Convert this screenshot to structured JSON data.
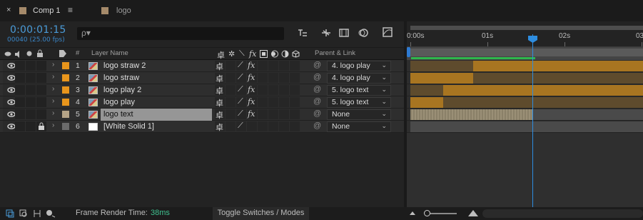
{
  "tabs": {
    "active": {
      "close": "×",
      "label": "Comp 1",
      "menu": "≡",
      "color": "#a58a6a"
    },
    "inactive": {
      "label": "logo",
      "color": "#a58a6a"
    }
  },
  "header": {
    "timecode": "0:00:01:15",
    "frames": "00040 (25.00 fps)",
    "search_glyph": "ρ▾"
  },
  "columns": {
    "hash": "#",
    "layer_name": "Layer Name",
    "parent_link": "Parent & Link"
  },
  "layers": [
    {
      "num": "1",
      "name": "logo straw 2",
      "label_color": "#e8951c",
      "parent": "4. logo play",
      "selected": false,
      "locked": false,
      "thumb": "footage"
    },
    {
      "num": "2",
      "name": "logo straw",
      "label_color": "#e8951c",
      "parent": "4. logo play",
      "selected": false,
      "locked": false,
      "thumb": "footage"
    },
    {
      "num": "3",
      "name": "logo play 2",
      "label_color": "#e8951c",
      "parent": "5. logo text",
      "selected": false,
      "locked": false,
      "thumb": "footage"
    },
    {
      "num": "4",
      "name": "logo play",
      "label_color": "#e8951c",
      "parent": "5. logo text",
      "selected": false,
      "locked": false,
      "thumb": "footage"
    },
    {
      "num": "5",
      "name": "logo text",
      "label_color": "#b5a487",
      "parent": "None",
      "selected": true,
      "locked": false,
      "thumb": "footage"
    },
    {
      "num": "6",
      "name": "[White Solid 1]",
      "label_color": "#6b6b6b",
      "parent": "None",
      "selected": false,
      "locked": true,
      "thumb": "white"
    }
  ],
  "switch_glyphs": {
    "shy": "卓",
    "collapse": "✲",
    "quality": "⟍",
    "fx": "fx"
  },
  "parent_spiral": "@",
  "timeline": {
    "ticks": [
      "0:00s",
      "01s",
      "02s",
      "03"
    ],
    "current_time_fraction": 0.64
  },
  "footer": {
    "frame_render_label": "Frame Render Time:",
    "frame_render_value": "38ms",
    "toggle_label": "Toggle Switches / Modes"
  }
}
